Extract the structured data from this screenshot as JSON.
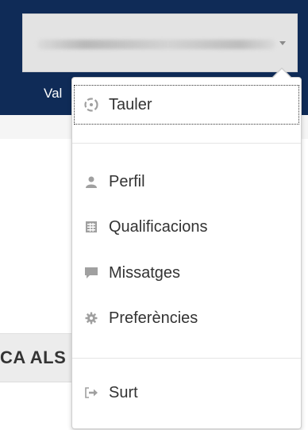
{
  "header": {
    "user_name_partial": "Val",
    "colors": {
      "navbar": "#0f2b57",
      "dropdown_bg": "#ffffff",
      "text": "#333333",
      "icon": "#999999"
    }
  },
  "page": {
    "section_heading_partial": "CA ALS"
  },
  "user_menu": {
    "items": [
      {
        "label": "Tauler",
        "icon": "dashboard-icon",
        "focused": true
      },
      {
        "label": "Perfil",
        "icon": "user-icon"
      },
      {
        "label": "Qualificacions",
        "icon": "table-icon"
      },
      {
        "label": "Missatges",
        "icon": "comment-icon"
      },
      {
        "label": "Preferències",
        "icon": "cog-icon"
      },
      {
        "label": "Surt",
        "icon": "sign-out-icon"
      }
    ]
  }
}
